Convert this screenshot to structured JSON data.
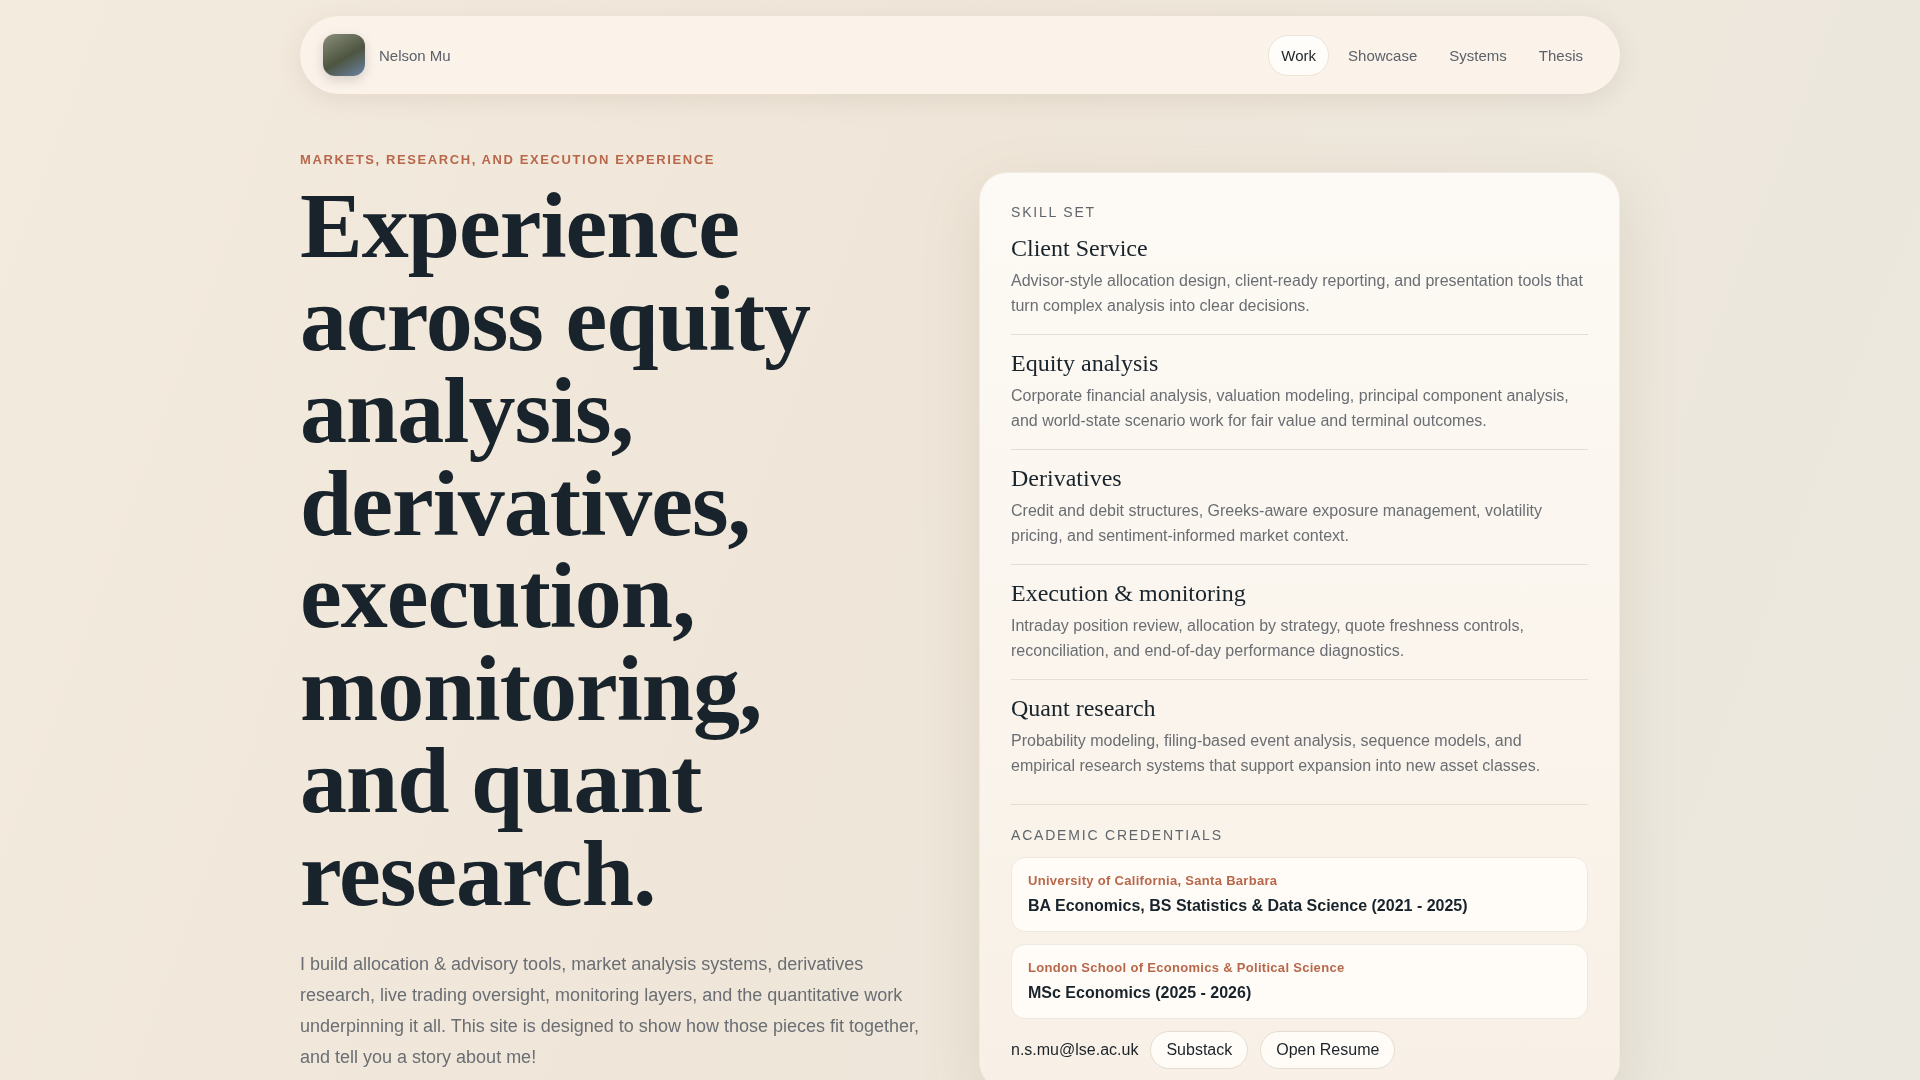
{
  "nav": {
    "name": "Nelson Mu",
    "links": [
      {
        "label": "Work",
        "selected": true
      },
      {
        "label": "Showcase",
        "selected": false
      },
      {
        "label": "Systems",
        "selected": false
      },
      {
        "label": "Thesis",
        "selected": false
      }
    ]
  },
  "hero": {
    "eyebrow": "MARKETS, RESEARCH, AND EXECUTION EXPERIENCE",
    "headline": "Experience across equity analysis, derivatives, execution, monitoring, and quant research.",
    "intro": "I build allocation & advisory tools, market analysis systems, derivatives research, live trading oversight, monitoring layers, and the quantitative work underpinning it all. This site is designed to show how those pieces fit together, and tell you a story about me!"
  },
  "panel": {
    "skills_heading": "SKILL SET",
    "skills": [
      {
        "title": "Client Service",
        "description": "Advisor-style allocation design, client-ready reporting, and presentation tools that turn complex analysis into clear decisions."
      },
      {
        "title": "Equity analysis",
        "description": "Corporate financial analysis, valuation modeling, principal component analysis, and world-state scenario work for fair value and terminal outcomes."
      },
      {
        "title": "Derivatives",
        "description": "Credit and debit structures, Greeks-aware exposure management, volatility pricing, and sentiment-informed market context."
      },
      {
        "title": "Execution & monitoring",
        "description": "Intraday position review, allocation by strategy, quote freshness controls, reconciliation, and end-of-day performance diagnostics."
      },
      {
        "title": "Quant research",
        "description": "Probability modeling, filing-based event analysis, sequence models, and empirical research systems that support expansion into new asset classes."
      }
    ],
    "credentials_heading": "ACADEMIC CREDENTIALS",
    "credentials": [
      {
        "school": "University of California, Santa Barbara",
        "degree": "BA Economics, BS Statistics & Data Science (2021 - 2025)"
      },
      {
        "school": "London School of Economics & Political Science",
        "degree": "MSc Economics (2025 - 2026)"
      }
    ],
    "email": "n.s.mu@lse.ac.uk",
    "buttons": [
      "Substack",
      "Open Resume"
    ]
  }
}
